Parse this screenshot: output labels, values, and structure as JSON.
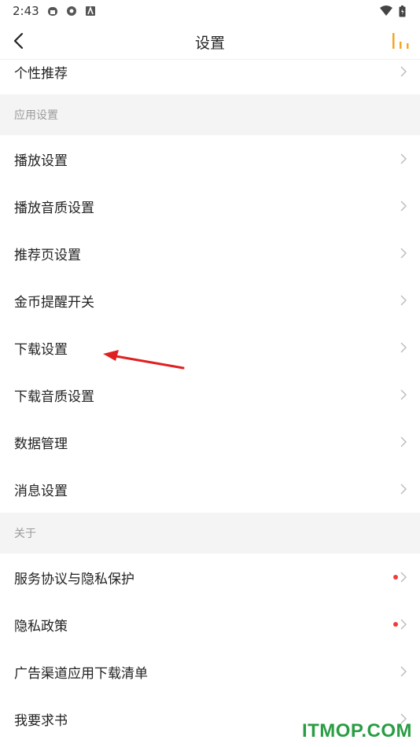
{
  "status_bar": {
    "time": "2:43"
  },
  "header": {
    "title": "设置"
  },
  "items": {
    "top": "个性推荐",
    "section_app": "应用设置",
    "play_settings": "播放设置",
    "play_quality": "播放音质设置",
    "recommend_page": "推荐页设置",
    "coin_reminder": "金币提醒开关",
    "download_settings": "下载设置",
    "download_quality": "下载音质设置",
    "data_management": "数据管理",
    "message_settings": "消息设置",
    "section_about": "关于",
    "service_agreement": "服务协议与隐私保护",
    "privacy_policy": "隐私政策",
    "ad_channel_list": "广告渠道应用下载清单",
    "request_book": "我要求书"
  },
  "watermark": "ITMOP.COM",
  "colors": {
    "accent": "#f5a623",
    "badge": "#f23a3a",
    "annotation": "#e02020"
  }
}
